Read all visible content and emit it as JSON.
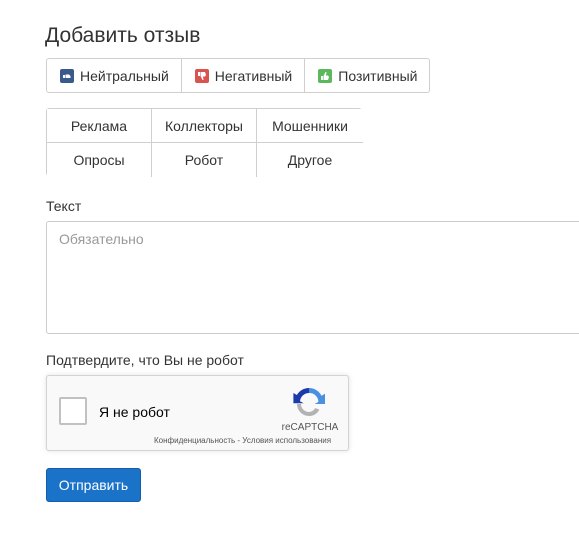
{
  "form": {
    "title": "Добавить отзыв",
    "sentiment_buttons": [
      {
        "label": "Нейтральный",
        "icon": "neutral-icon",
        "color": "#3a5a8c"
      },
      {
        "label": "Негативный",
        "icon": "thumbs-down-icon",
        "color": "#d9534f"
      },
      {
        "label": "Позитивный",
        "icon": "thumbs-up-icon",
        "color": "#5cb85c"
      }
    ],
    "categories": [
      "Реклама",
      "Коллекторы",
      "Мошенники",
      "Опросы",
      "Робот",
      "Другое"
    ],
    "text_label": "Текст",
    "text_placeholder": "Обязательно",
    "captcha_label": "Подтвердите, что Вы не робот",
    "captcha": {
      "checkbox_label": "Я не робот",
      "brand": "reCAPTCHA",
      "privacy": "Конфиденциальность",
      "separator": " - ",
      "terms": "Условия использования"
    },
    "submit_label": "Отправить"
  }
}
